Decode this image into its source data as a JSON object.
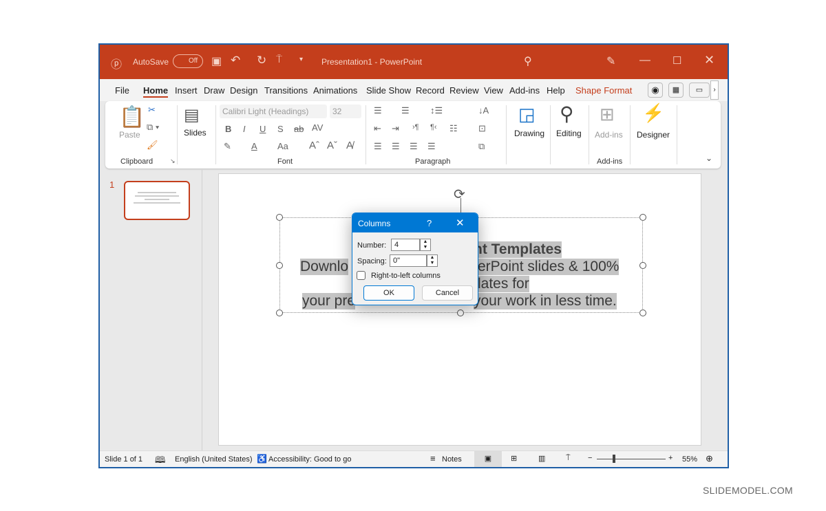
{
  "titlebar": {
    "autosave_label": "AutoSave",
    "autosave_state": "Off",
    "title": "Presentation1  -  PowerPoint"
  },
  "tabs": [
    "File",
    "Home",
    "Insert",
    "Draw",
    "Design",
    "Transitions",
    "Animations",
    "Slide Show",
    "Record",
    "Review",
    "View",
    "Add-ins",
    "Help",
    "Shape Format"
  ],
  "active_tab": "Home",
  "ribbon": {
    "paste": "Paste",
    "clipboard": "Clipboard",
    "slides": "Slides",
    "font_name": "Calibri Light (Headings)",
    "font_size": "32",
    "font": "Font",
    "paragraph": "Paragraph",
    "drawing": "Drawing",
    "editing": "Editing",
    "addins_btn": "Add-ins",
    "addins_group": "Add-ins",
    "designer": "Designer"
  },
  "thumbnail": {
    "number": "1"
  },
  "slide_text": {
    "l1": "nt Templates",
    "l2a": "Downlo",
    "l2b": "erPoint slides & 100%",
    "l3": "lates for",
    "l4a": "your pre",
    "l4b": "your work in less time."
  },
  "dialog": {
    "title": "Columns",
    "help": "?",
    "number_label": "Number:",
    "number_value": "4",
    "spacing_label": "Spacing:",
    "spacing_value": "0\"",
    "rtl_label": "Right-to-left columns",
    "rtl_checked": false,
    "ok": "OK",
    "cancel": "Cancel"
  },
  "status": {
    "slide": "Slide 1 of 1",
    "language": "English (United States)",
    "accessibility": "Accessibility: Good to go",
    "notes": "Notes",
    "zoom": "55%",
    "zoom_level": 55
  },
  "watermark": "SLIDEMODEL.COM",
  "colors": {
    "title_bar": "#c43e1c",
    "dialog_accent": "#0078d4",
    "shape_format": "#c43e1c"
  }
}
